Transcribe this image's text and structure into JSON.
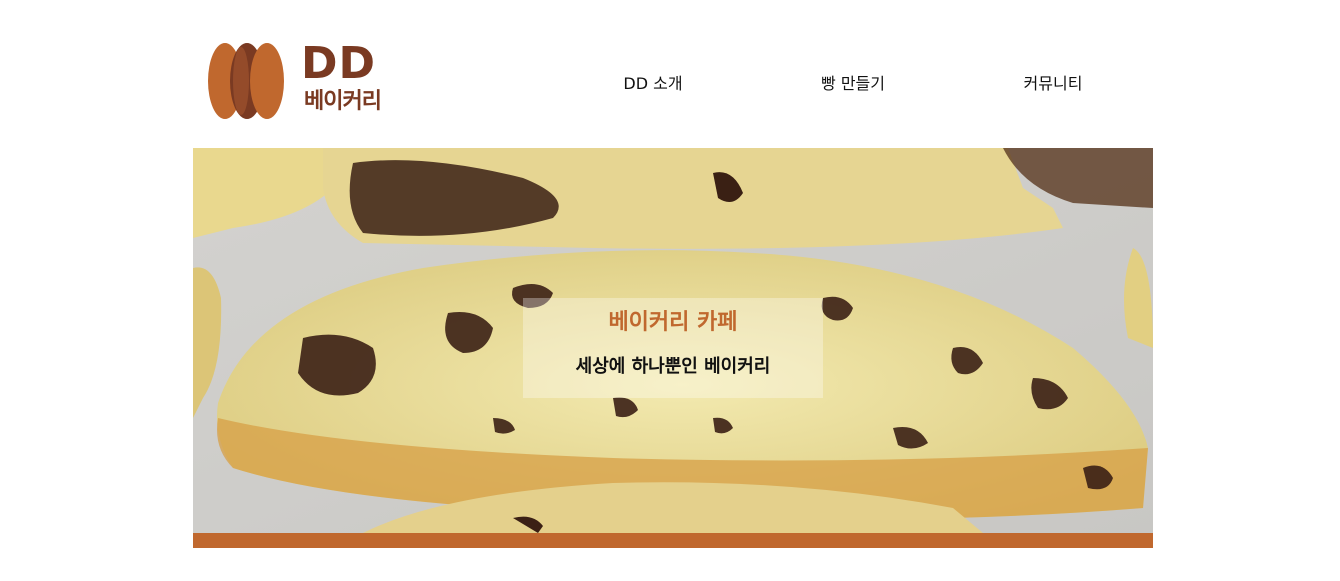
{
  "brand": {
    "name": "DD",
    "subtitle": "베이커리",
    "colors": {
      "dark": "#7a3a22",
      "accent": "#c0682e"
    }
  },
  "nav": {
    "items": [
      {
        "label": "DD 소개"
      },
      {
        "label": "빵 만들기"
      },
      {
        "label": "커뮤니티"
      }
    ]
  },
  "hero": {
    "title": "베이커리 카페",
    "subtitle": "세상에 하나뿐인 베이커리",
    "image": "biscotti-photo",
    "bar_color": "#c0682e"
  }
}
